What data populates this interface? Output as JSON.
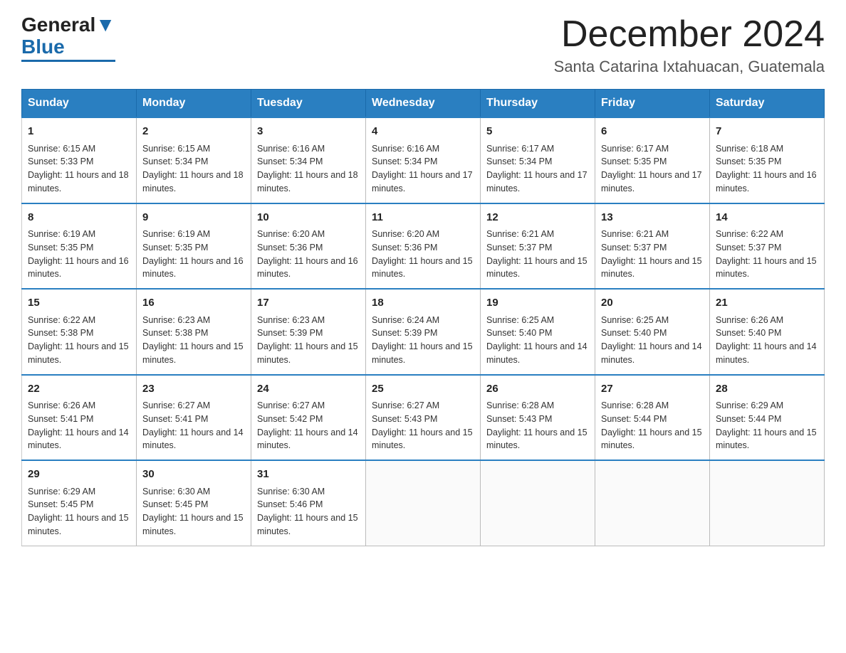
{
  "logo": {
    "text1": "General",
    "text2": "Blue"
  },
  "header": {
    "month": "December 2024",
    "location": "Santa Catarina Ixtahuacan, Guatemala"
  },
  "days_of_week": [
    "Sunday",
    "Monday",
    "Tuesday",
    "Wednesday",
    "Thursday",
    "Friday",
    "Saturday"
  ],
  "weeks": [
    [
      {
        "day": "1",
        "sunrise": "6:15 AM",
        "sunset": "5:33 PM",
        "daylight": "11 hours and 18 minutes."
      },
      {
        "day": "2",
        "sunrise": "6:15 AM",
        "sunset": "5:34 PM",
        "daylight": "11 hours and 18 minutes."
      },
      {
        "day": "3",
        "sunrise": "6:16 AM",
        "sunset": "5:34 PM",
        "daylight": "11 hours and 18 minutes."
      },
      {
        "day": "4",
        "sunrise": "6:16 AM",
        "sunset": "5:34 PM",
        "daylight": "11 hours and 17 minutes."
      },
      {
        "day": "5",
        "sunrise": "6:17 AM",
        "sunset": "5:34 PM",
        "daylight": "11 hours and 17 minutes."
      },
      {
        "day": "6",
        "sunrise": "6:17 AM",
        "sunset": "5:35 PM",
        "daylight": "11 hours and 17 minutes."
      },
      {
        "day": "7",
        "sunrise": "6:18 AM",
        "sunset": "5:35 PM",
        "daylight": "11 hours and 16 minutes."
      }
    ],
    [
      {
        "day": "8",
        "sunrise": "6:19 AM",
        "sunset": "5:35 PM",
        "daylight": "11 hours and 16 minutes."
      },
      {
        "day": "9",
        "sunrise": "6:19 AM",
        "sunset": "5:35 PM",
        "daylight": "11 hours and 16 minutes."
      },
      {
        "day": "10",
        "sunrise": "6:20 AM",
        "sunset": "5:36 PM",
        "daylight": "11 hours and 16 minutes."
      },
      {
        "day": "11",
        "sunrise": "6:20 AM",
        "sunset": "5:36 PM",
        "daylight": "11 hours and 15 minutes."
      },
      {
        "day": "12",
        "sunrise": "6:21 AM",
        "sunset": "5:37 PM",
        "daylight": "11 hours and 15 minutes."
      },
      {
        "day": "13",
        "sunrise": "6:21 AM",
        "sunset": "5:37 PM",
        "daylight": "11 hours and 15 minutes."
      },
      {
        "day": "14",
        "sunrise": "6:22 AM",
        "sunset": "5:37 PM",
        "daylight": "11 hours and 15 minutes."
      }
    ],
    [
      {
        "day": "15",
        "sunrise": "6:22 AM",
        "sunset": "5:38 PM",
        "daylight": "11 hours and 15 minutes."
      },
      {
        "day": "16",
        "sunrise": "6:23 AM",
        "sunset": "5:38 PM",
        "daylight": "11 hours and 15 minutes."
      },
      {
        "day": "17",
        "sunrise": "6:23 AM",
        "sunset": "5:39 PM",
        "daylight": "11 hours and 15 minutes."
      },
      {
        "day": "18",
        "sunrise": "6:24 AM",
        "sunset": "5:39 PM",
        "daylight": "11 hours and 15 minutes."
      },
      {
        "day": "19",
        "sunrise": "6:25 AM",
        "sunset": "5:40 PM",
        "daylight": "11 hours and 14 minutes."
      },
      {
        "day": "20",
        "sunrise": "6:25 AM",
        "sunset": "5:40 PM",
        "daylight": "11 hours and 14 minutes."
      },
      {
        "day": "21",
        "sunrise": "6:26 AM",
        "sunset": "5:40 PM",
        "daylight": "11 hours and 14 minutes."
      }
    ],
    [
      {
        "day": "22",
        "sunrise": "6:26 AM",
        "sunset": "5:41 PM",
        "daylight": "11 hours and 14 minutes."
      },
      {
        "day": "23",
        "sunrise": "6:27 AM",
        "sunset": "5:41 PM",
        "daylight": "11 hours and 14 minutes."
      },
      {
        "day": "24",
        "sunrise": "6:27 AM",
        "sunset": "5:42 PM",
        "daylight": "11 hours and 14 minutes."
      },
      {
        "day": "25",
        "sunrise": "6:27 AM",
        "sunset": "5:43 PM",
        "daylight": "11 hours and 15 minutes."
      },
      {
        "day": "26",
        "sunrise": "6:28 AM",
        "sunset": "5:43 PM",
        "daylight": "11 hours and 15 minutes."
      },
      {
        "day": "27",
        "sunrise": "6:28 AM",
        "sunset": "5:44 PM",
        "daylight": "11 hours and 15 minutes."
      },
      {
        "day": "28",
        "sunrise": "6:29 AM",
        "sunset": "5:44 PM",
        "daylight": "11 hours and 15 minutes."
      }
    ],
    [
      {
        "day": "29",
        "sunrise": "6:29 AM",
        "sunset": "5:45 PM",
        "daylight": "11 hours and 15 minutes."
      },
      {
        "day": "30",
        "sunrise": "6:30 AM",
        "sunset": "5:45 PM",
        "daylight": "11 hours and 15 minutes."
      },
      {
        "day": "31",
        "sunrise": "6:30 AM",
        "sunset": "5:46 PM",
        "daylight": "11 hours and 15 minutes."
      },
      null,
      null,
      null,
      null
    ]
  ]
}
